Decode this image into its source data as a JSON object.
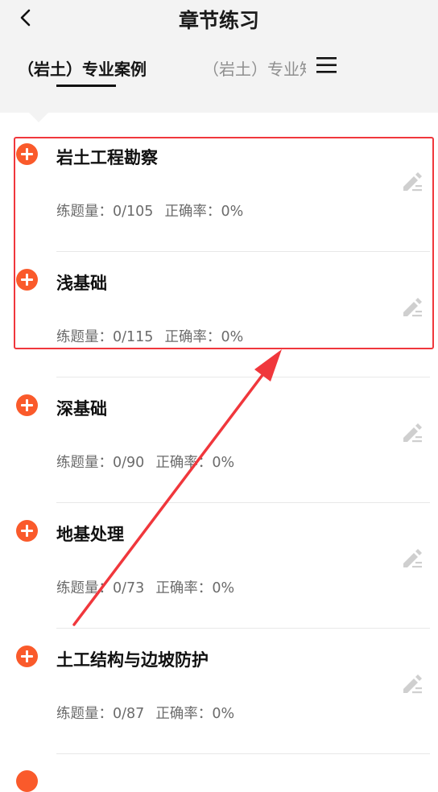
{
  "header": {
    "title": "章节练习",
    "tabs": [
      {
        "label": "（岩土）专业案例",
        "active": true
      },
      {
        "label": "（岩土）专业知识",
        "active": false
      }
    ]
  },
  "chapters": [
    {
      "name": "岩土工程勘察",
      "practice_label": "练题量：",
      "practice": "0/105",
      "accuracy_label": "正确率：",
      "accuracy": "0%"
    },
    {
      "name": "浅基础",
      "practice_label": "练题量：",
      "practice": "0/115",
      "accuracy_label": "正确率：",
      "accuracy": "0%"
    },
    {
      "name": "深基础",
      "practice_label": "练题量：",
      "practice": "0/90",
      "accuracy_label": "正确率：",
      "accuracy": "0%"
    },
    {
      "name": "地基处理",
      "practice_label": "练题量：",
      "practice": "0/73",
      "accuracy_label": "正确率：",
      "accuracy": "0%"
    },
    {
      "name": "土工结构与边坡防护",
      "practice_label": "练题量：",
      "practice": "0/87",
      "accuracy_label": "正确率：",
      "accuracy": "0%"
    }
  ],
  "colors": {
    "accent": "#fa5a2b",
    "annotation": "#f0373c",
    "header_bg": "#f3f3f3"
  },
  "icons": {
    "back": "chevron-left-icon",
    "menu": "hamburger-menu-icon",
    "expand": "plus-circle-icon",
    "edit": "pencil-edit-icon"
  }
}
